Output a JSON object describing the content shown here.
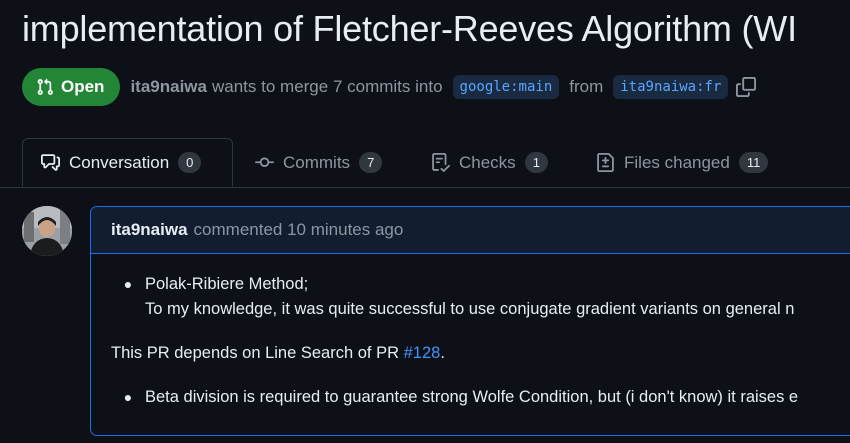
{
  "pr": {
    "title": "implementation of Fletcher-Reeves Algorithm (WI",
    "status": "Open",
    "author": "ita9naiwa",
    "merge_text": "wants to merge 7 commits into",
    "base_branch": "google:main",
    "from_text": "from",
    "head_branch": "ita9naiwa:fr"
  },
  "tabs": [
    {
      "label": "Conversation",
      "count": "0",
      "icon": "comment-discussion-icon"
    },
    {
      "label": "Commits",
      "count": "7",
      "icon": "git-commit-icon"
    },
    {
      "label": "Checks",
      "count": "1",
      "icon": "checklist-icon"
    },
    {
      "label": "Files changed",
      "count": "11",
      "icon": "file-diff-icon"
    }
  ],
  "comment": {
    "author": "ita9naiwa",
    "action": "commented 10 minutes ago",
    "bullet1_line1": "Polak-Ribiere Method;",
    "bullet1_line2": "To my knowledge, it was quite successful to use conjugate gradient variants on general n",
    "para_text": "This PR depends on Line Search of PR ",
    "para_link": "#128",
    "para_end": ".",
    "bullet2": "Beta division is required to guarantee strong Wolfe Condition, but (i don't know) it raises e"
  },
  "colors": {
    "open_green": "#238636",
    "link_blue": "#4493f8",
    "comment_border": "#1f6feb"
  }
}
